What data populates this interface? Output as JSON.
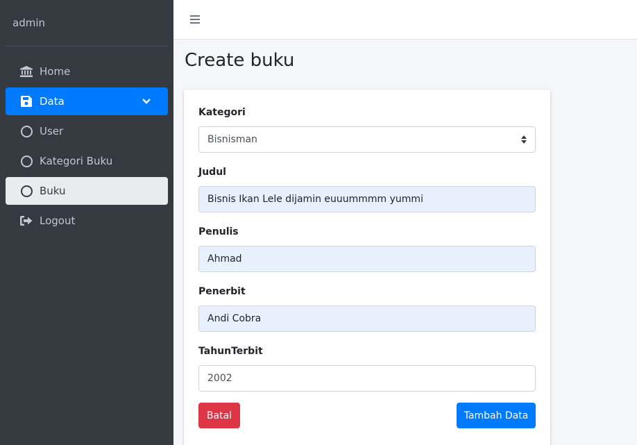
{
  "sidebar": {
    "brand": "admin",
    "items": [
      {
        "label": "Home",
        "icon": "bank-icon"
      },
      {
        "label": "Data",
        "icon": "floppy-disk-icon"
      },
      {
        "label": "User",
        "icon": "circle-icon"
      },
      {
        "label": "Kategori Buku",
        "icon": "circle-icon"
      },
      {
        "label": "Buku",
        "icon": "circle-icon"
      },
      {
        "label": "Logout",
        "icon": "sign-out-icon"
      }
    ]
  },
  "page": {
    "title": "Create buku"
  },
  "form": {
    "kategori": {
      "label": "Kategori",
      "value": "Bisnisman"
    },
    "judul": {
      "label": "Judul",
      "value": "Bisnis Ikan Lele dijamin euuummmm yummi"
    },
    "penulis": {
      "label": "Penulis",
      "value": "Ahmad"
    },
    "penerbit": {
      "label": "Penerbit",
      "value": "Andi Cobra"
    },
    "tahun": {
      "label": "TahunTerbit",
      "value": "2002"
    },
    "cancel_label": "Batal",
    "submit_label": "Tambah Data"
  },
  "colors": {
    "sidebar_bg": "#343a40",
    "primary": "#007bff",
    "danger": "#dc3545",
    "autofill": "#e8f0fe"
  }
}
